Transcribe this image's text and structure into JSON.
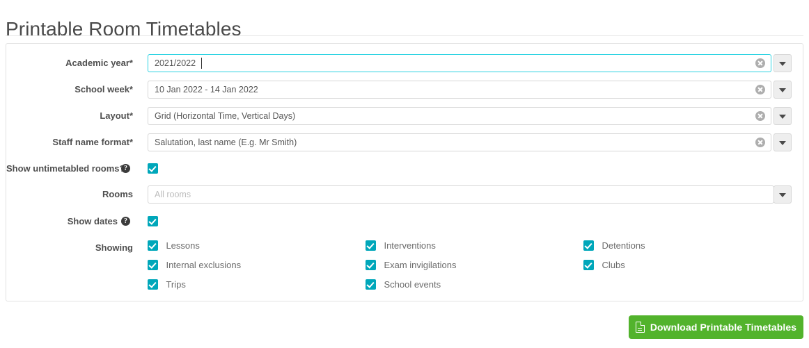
{
  "page": {
    "title": "Printable Room Timetables"
  },
  "form": {
    "fields": [
      {
        "label": "Academic year*",
        "value": "2021/2022",
        "is_placeholder": false,
        "focused": true,
        "has_clear": true,
        "has_dropdown": true
      },
      {
        "label": "School week*",
        "value": "10 Jan 2022 - 14 Jan 2022",
        "is_placeholder": false,
        "focused": false,
        "has_clear": true,
        "has_dropdown": true
      },
      {
        "label": "Layout*",
        "value": "Grid (Horizontal Time, Vertical Days)",
        "is_placeholder": false,
        "focused": false,
        "has_clear": true,
        "has_dropdown": true
      },
      {
        "label": "Staff name format*",
        "value": "Salutation, last name (E.g. Mr Smith)",
        "is_placeholder": false,
        "focused": false,
        "has_clear": true,
        "has_dropdown": true
      }
    ],
    "show_untimetabled_rooms": {
      "label": "Show untimetabled rooms?",
      "help_icon": "help-circle-icon",
      "help_glyph": "?",
      "checked": true
    },
    "rooms": {
      "label": "Rooms",
      "placeholder": "All rooms",
      "value": "All rooms",
      "is_placeholder": true,
      "has_clear": false,
      "has_dropdown": true
    },
    "show_dates": {
      "label": "Show dates",
      "help_icon": "help-circle-icon",
      "help_glyph": "?",
      "checked": true
    },
    "showing": {
      "label": "Showing",
      "columns": [
        [
          "Lessons",
          "Internal exclusions",
          "Trips"
        ],
        [
          "Interventions",
          "Exam invigilations",
          "School events"
        ],
        [
          "Detentions",
          "Clubs"
        ]
      ],
      "all_checked": true
    }
  },
  "actions": {
    "download": {
      "label": "Download Printable Timetables",
      "icon": "pdf-file-icon"
    }
  },
  "colors": {
    "accent_teal": "#00a7ba",
    "focus_border": "#2ad2e2",
    "download_green": "#52b32c",
    "label_text": "#4f4f4f",
    "value_text": "#555555",
    "placeholder_text": "#bdbdbd",
    "border": "#d6d6d6"
  }
}
